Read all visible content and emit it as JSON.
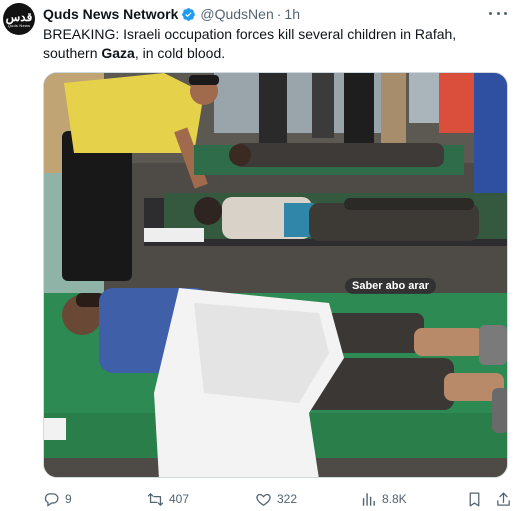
{
  "author": {
    "display_name": "Quds News Network",
    "handle": "@QudsNen",
    "separator": "·",
    "time": "1h",
    "avatar_logo": "قدس",
    "avatar_sub": "Quds News",
    "verified_icon": "verified-badge-icon"
  },
  "tweet": {
    "text_part1": "BREAKING: Israeli occupation forces kill several children in Rafah, southern ",
    "text_bold": "Gaza",
    "text_part2": ", in cold blood."
  },
  "media": {
    "watermark": "Saber abo arar"
  },
  "actions": {
    "replies": "9",
    "reposts": "407",
    "likes": "322",
    "views": "8.8K"
  },
  "icons": {
    "reply": "reply-icon",
    "repost": "retweet-icon",
    "like": "heart-icon",
    "views": "views-chart-icon",
    "bookmark": "bookmark-icon",
    "share": "share-icon",
    "more": "more-options-icon"
  },
  "colors": {
    "text": "#0f1419",
    "secondary": "#536471",
    "verified": "#1d9bf0",
    "border": "#cfd9de"
  }
}
